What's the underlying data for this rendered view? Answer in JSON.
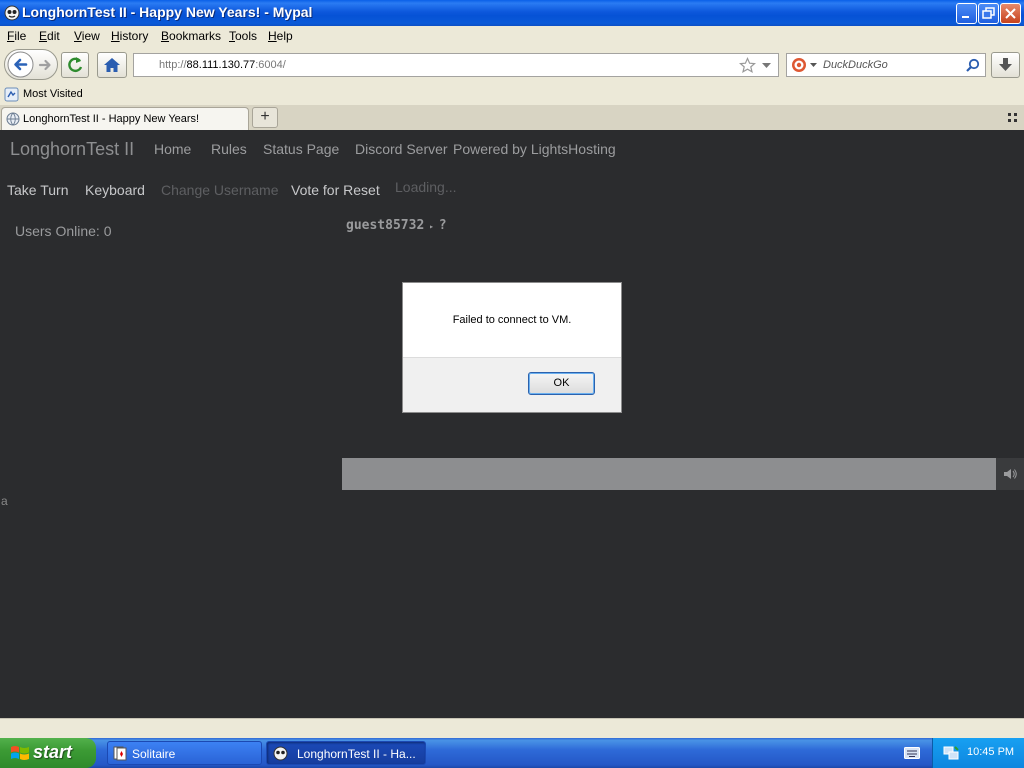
{
  "window": {
    "title": "LonghornTest II - Happy New Years! - Mypal"
  },
  "menu": {
    "items": [
      {
        "key": "F",
        "rest": "ile"
      },
      {
        "key": "E",
        "rest": "dit"
      },
      {
        "key": "V",
        "rest": "iew"
      },
      {
        "key": "H",
        "rest": "istory"
      },
      {
        "key": "B",
        "rest": "ookmarks"
      },
      {
        "key": "T",
        "rest": "ools"
      },
      {
        "key": "H",
        "rest": "elp"
      }
    ]
  },
  "navbar": {
    "url_prefix": "http://",
    "url_host": "88.111.130.77",
    "url_port": ":6004/",
    "search_placeholder": "DuckDuckGo"
  },
  "bookmarks": {
    "most_visited": "Most Visited"
  },
  "tab": {
    "label": "LonghornTest II - Happy New Years!",
    "new_tab": "+"
  },
  "site": {
    "brand": "LonghornTest II",
    "nav": [
      "Home",
      "Rules",
      "Status Page",
      "Discord Server",
      "Powered by LightsHosting"
    ],
    "actions": {
      "take_turn": "Take Turn",
      "keyboard": "Keyboard",
      "change_username": "Change Username",
      "vote_reset": "Vote for Reset",
      "loading": "Loading..."
    },
    "users_online": "Users Online: 0",
    "username": "guest85732",
    "username_suffix": "?",
    "side_text": "a"
  },
  "dialog": {
    "message": "Failed to connect to VM.",
    "ok_label": "OK"
  },
  "taskbar": {
    "start_label": "start",
    "items": [
      "Solitaire",
      "LonghornTest II - Ha..."
    ],
    "clock": "10:45 PM"
  },
  "colors": {
    "page_bg": "#2b2c2e",
    "xp_blue": "#0a5fe8",
    "start_green": "#3c9b35"
  }
}
